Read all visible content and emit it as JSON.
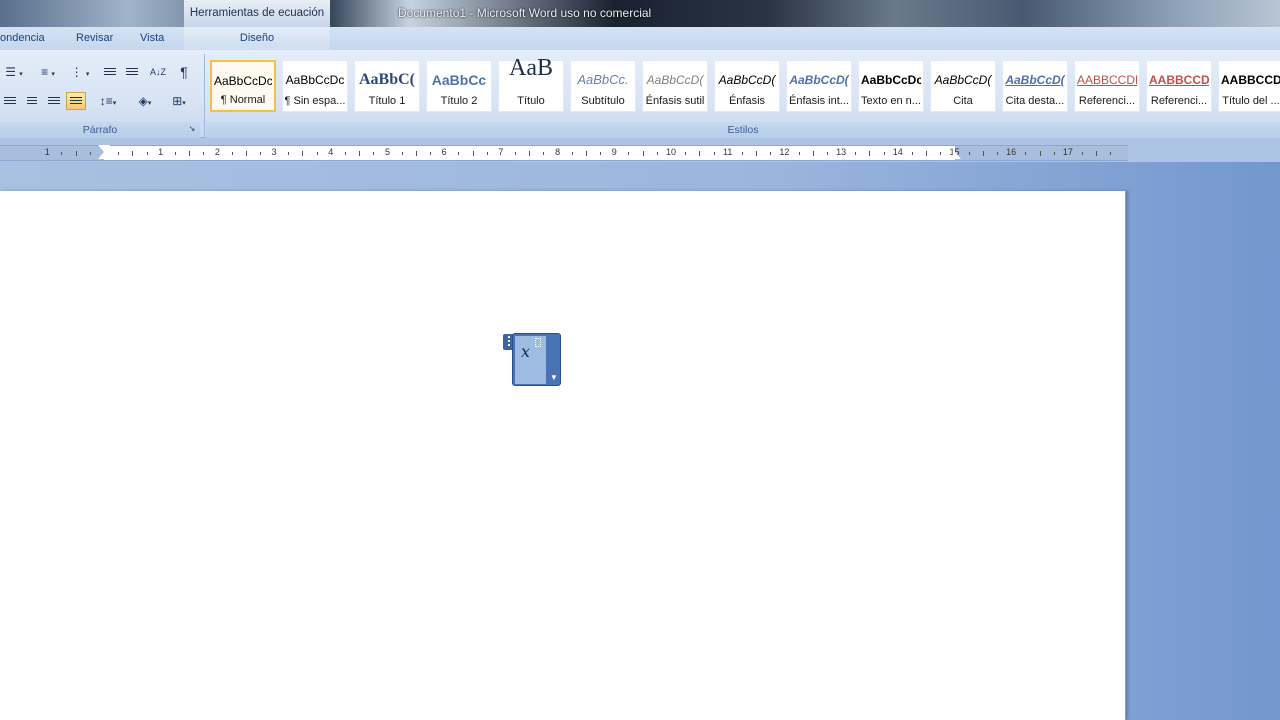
{
  "window": {
    "tool_context_title": "Herramientas de ecuación",
    "document_title": "Documento1 - Microsoft Word uso no comercial"
  },
  "tabs": [
    {
      "label": "ondencia"
    },
    {
      "label": "Revisar"
    },
    {
      "label": "Vista"
    },
    {
      "label": "Diseño"
    }
  ],
  "ribbon": {
    "groups": {
      "paragraph": "Párrafo",
      "styles": "Estilos"
    },
    "paragraph_icons": [
      "bullets-icon",
      "numbering-icon",
      "multilevel-list-icon",
      "decrease-indent-icon",
      "increase-indent-icon",
      "sort-icon",
      "pilcrow-icon",
      "align-left-icon",
      "align-center-icon",
      "align-right-icon",
      "justify-icon",
      "line-spacing-icon",
      "shading-icon",
      "borders-icon",
      "dialog-launcher-icon"
    ],
    "pilcrow": "¶",
    "sort": "A↓Z",
    "styles": [
      {
        "sample": "AaBbCcDc",
        "name": "¶ Normal"
      },
      {
        "sample": "AaBbCcDc",
        "name": "¶ Sin espa..."
      },
      {
        "sample": "AaBbC(",
        "name": "Título 1"
      },
      {
        "sample": "AaBbCc",
        "name": "Título 2"
      },
      {
        "sample": "AaB",
        "name": "Título"
      },
      {
        "sample": "AaBbCc.",
        "name": "Subtítulo"
      },
      {
        "sample": "AaBbCcD(",
        "name": "Énfasis sutil"
      },
      {
        "sample": "AaBbCcD(",
        "name": "Énfasis"
      },
      {
        "sample": "AaBbCcD(",
        "name": "Énfasis int..."
      },
      {
        "sample": "AaBbCcDc",
        "name": "Texto en n..."
      },
      {
        "sample": "AaBbCcD(",
        "name": "Cita"
      },
      {
        "sample": "AaBbCcD(",
        "name": "Cita desta..."
      },
      {
        "sample": "AABBCCDD",
        "name": "Referenci..."
      },
      {
        "sample": "AABBCCDD",
        "name": "Referenci..."
      },
      {
        "sample": "AABBCCDI",
        "name": "Título del ..."
      }
    ]
  },
  "ruler": {
    "numbers": [
      "1",
      "1",
      "2",
      "3",
      "4",
      "5",
      "6",
      "7",
      "8",
      "9",
      "10",
      "11",
      "12",
      "13",
      "14",
      "15",
      "16",
      "17"
    ]
  },
  "equation": {
    "variable": "x"
  },
  "colors": {
    "ribbon": "#d7e4f4",
    "tab_text": "#15428b",
    "selected_style": "#f3c14a",
    "equation_fill": "#4873b4"
  }
}
